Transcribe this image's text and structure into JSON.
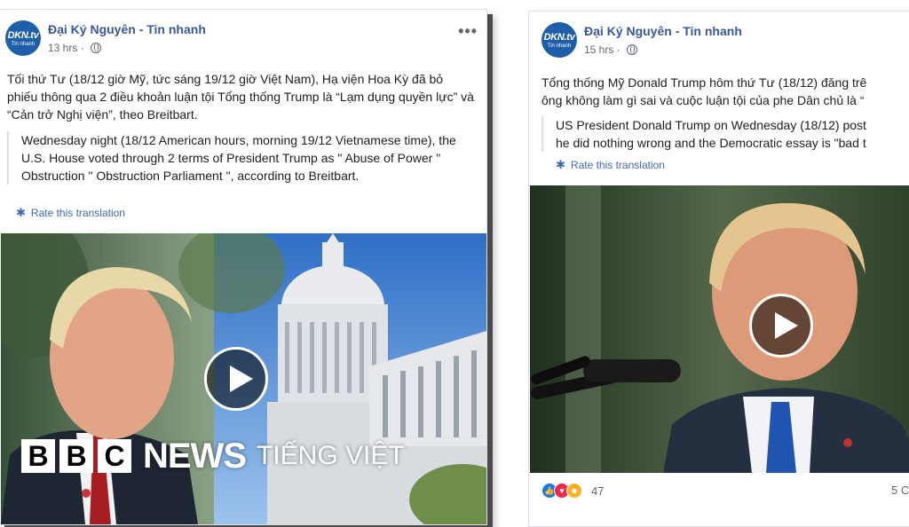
{
  "left_post": {
    "logo_main": "DKN.tv",
    "logo_sub": "Tin nhanh",
    "page_name": "Đại Ký Nguyên - Tin nhanh",
    "time": "13 hrs",
    "options": "•••",
    "text": "Tối thứ Tư (18/12 giờ Mỹ, tức sáng 19/12 giờ Việt Nam), Hạ viện Hoa Kỳ đã bỏ phiếu thông qua 2 điều khoản luận tội Tổng thống Trump là “Lạm dụng quyền lực” và “Cản trở Nghị viện”, theo Breitbart.",
    "translation": "Wednesday night (18/12 American hours, morning 19/12 Vietnamese time), the U.S. House voted through 2 terms of President Trump as \" Abuse of Power \" Obstruction \" Obstruction Parliament \", according to Breitbart.",
    "rate_translation": "Rate this translation"
  },
  "right_post": {
    "logo_main": "DKN.tv",
    "logo_sub": "Tin nhanh",
    "page_name": "Đại Ký Nguyên - Tin nhanh",
    "time": "15 hrs",
    "text_line1": "Tổng thống Mỹ Donald Trump hôm thứ Tư (18/12) đăng trê",
    "text_line2": "ông không làm gì sai và cuộc luận tội của phe Dân chủ là “",
    "translation_line1": "US President Donald Trump on Wednesday (18/12) post",
    "translation_line2": "he did nothing wrong and the Democratic essay is \"bad t",
    "rate_translation": "Rate this translation",
    "reaction_count": "47",
    "comments": "5 C"
  },
  "watermark": {
    "letters": [
      "B",
      "B",
      "C"
    ],
    "news": "NEWS",
    "service": "TIẾNG VIỆT"
  },
  "colors": {
    "link": "#385898",
    "accent": "#4267b2",
    "logo_bg": "#1f5ea8"
  }
}
